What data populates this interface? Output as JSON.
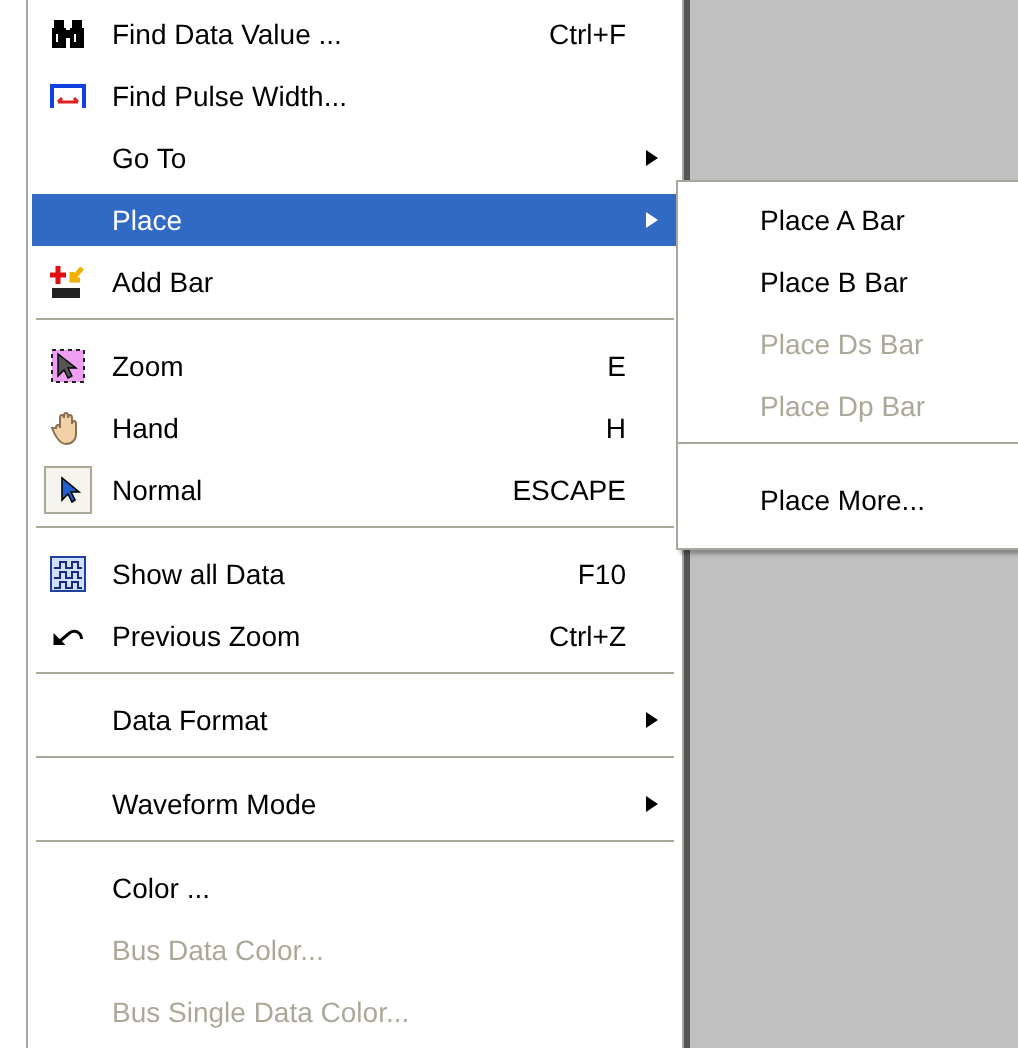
{
  "menu": {
    "items": [
      {
        "kind": "item",
        "label": "Find Data Value ...",
        "shortcut": "Ctrl+F",
        "submenu": false,
        "disabled": false,
        "selected": false,
        "checked": false
      },
      {
        "kind": "item",
        "label": "Find Pulse Width...",
        "submenu": false,
        "disabled": false,
        "selected": false,
        "checked": false
      },
      {
        "kind": "item",
        "label": "Go To",
        "submenu": true,
        "disabled": false,
        "selected": false,
        "checked": false
      },
      {
        "kind": "item",
        "label": "Place",
        "submenu": true,
        "disabled": false,
        "selected": true,
        "checked": false
      },
      {
        "kind": "item",
        "label": "Add Bar",
        "submenu": false,
        "disabled": false,
        "selected": false,
        "checked": false
      },
      {
        "kind": "separator"
      },
      {
        "kind": "item",
        "label": "Zoom",
        "shortcut": "E",
        "submenu": false,
        "disabled": false,
        "selected": false,
        "checked": false
      },
      {
        "kind": "item",
        "label": "Hand",
        "shortcut": "H",
        "submenu": false,
        "disabled": false,
        "selected": false,
        "checked": false
      },
      {
        "kind": "item",
        "label": "Normal",
        "shortcut": "ESCAPE",
        "submenu": false,
        "disabled": false,
        "selected": false,
        "checked": true
      },
      {
        "kind": "separator"
      },
      {
        "kind": "item",
        "label": "Show all Data",
        "shortcut": "F10",
        "submenu": false,
        "disabled": false,
        "selected": false,
        "checked": false
      },
      {
        "kind": "item",
        "label": "Previous Zoom",
        "shortcut": "Ctrl+Z",
        "submenu": false,
        "disabled": false,
        "selected": false,
        "checked": false
      },
      {
        "kind": "separator"
      },
      {
        "kind": "item",
        "label": "Data Format",
        "submenu": true,
        "disabled": false,
        "selected": false,
        "checked": false
      },
      {
        "kind": "separator"
      },
      {
        "kind": "item",
        "label": "Waveform Mode",
        "submenu": true,
        "disabled": false,
        "selected": false,
        "checked": false
      },
      {
        "kind": "separator"
      },
      {
        "kind": "item",
        "label": "Color ...",
        "submenu": false,
        "disabled": false,
        "selected": false,
        "checked": false
      },
      {
        "kind": "item",
        "label": "Bus Data Color...",
        "submenu": false,
        "disabled": true,
        "selected": false,
        "checked": false
      },
      {
        "kind": "item",
        "label": "Bus Single Data Color...",
        "submenu": false,
        "disabled": true,
        "selected": false,
        "checked": false
      }
    ]
  },
  "submenu": {
    "items": [
      {
        "kind": "item",
        "label": "Place A Bar",
        "disabled": false
      },
      {
        "kind": "item",
        "label": "Place B Bar",
        "disabled": false
      },
      {
        "kind": "item",
        "label": "Place Ds Bar",
        "disabled": true
      },
      {
        "kind": "item",
        "label": "Place Dp Bar",
        "disabled": true
      },
      {
        "kind": "separator"
      },
      {
        "kind": "item",
        "label": "Place More...",
        "disabled": false
      }
    ]
  }
}
